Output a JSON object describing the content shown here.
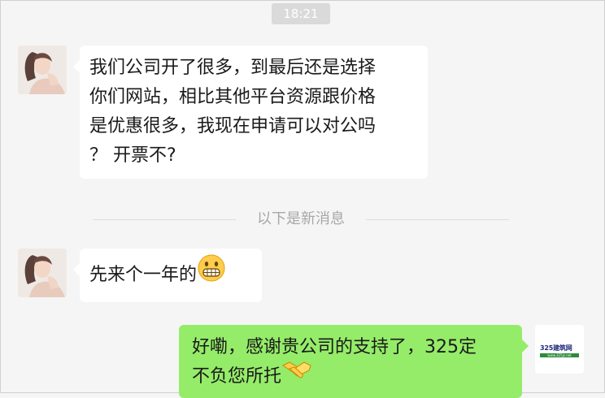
{
  "timestamp": "18:21",
  "messages": [
    {
      "sender": "contact",
      "text_lines": [
        "我们公司开了很多，到最后还是选择",
        "你们网站，相比其他平台资源跟价格",
        "是优惠很多，我现在申请可以对公吗",
        "？ 开票不?"
      ]
    },
    {
      "sender": "contact",
      "text": "先来个一年的",
      "emoji": "grinning-face-emoji"
    },
    {
      "sender": "self",
      "text_lines": [
        "好嘞，感谢贵公司的支持了，325定",
        "不负您所托"
      ],
      "emoji": "handshake-emoji"
    }
  ],
  "divider": {
    "label": "以下是新消息"
  },
  "self_avatar": {
    "brand_name": "325建筑网",
    "brand_url": "www.325jz.net"
  },
  "colors": {
    "background": "#f5f5f5",
    "incoming_bubble": "#ffffff",
    "outgoing_bubble": "#95ec69",
    "timestamp_pill": "#dadada"
  }
}
